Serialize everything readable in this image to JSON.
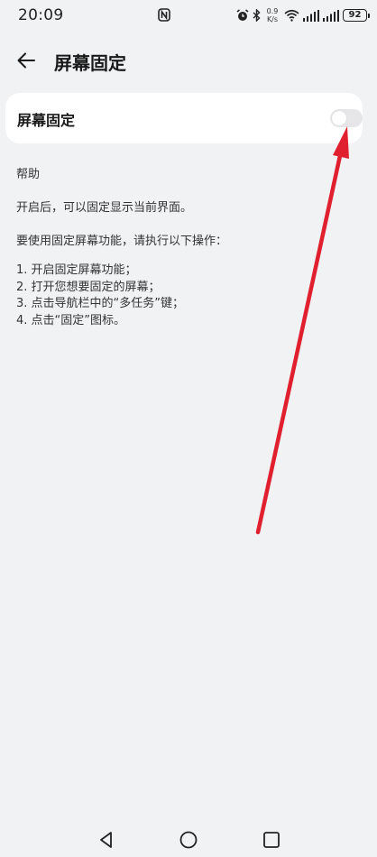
{
  "status_bar": {
    "time": "20:09",
    "net_speed_value": "0.9",
    "net_speed_unit": "K/s",
    "battery": "92"
  },
  "header": {
    "title": "屏幕固定"
  },
  "setting": {
    "label": "屏幕固定",
    "enabled": false
  },
  "help": {
    "title": "帮助",
    "intro": "开启后，可以固定显示当前界面。",
    "lead": "要使用固定屏幕功能，请执行以下操作：",
    "steps": [
      "1. 开启固定屏幕功能；",
      "2. 打开您想要固定的屏幕；",
      "3. 点击导航栏中的“多任务”键；",
      "4. 点击“固定”图标。"
    ]
  },
  "annotation": {
    "color": "#e0202e"
  }
}
